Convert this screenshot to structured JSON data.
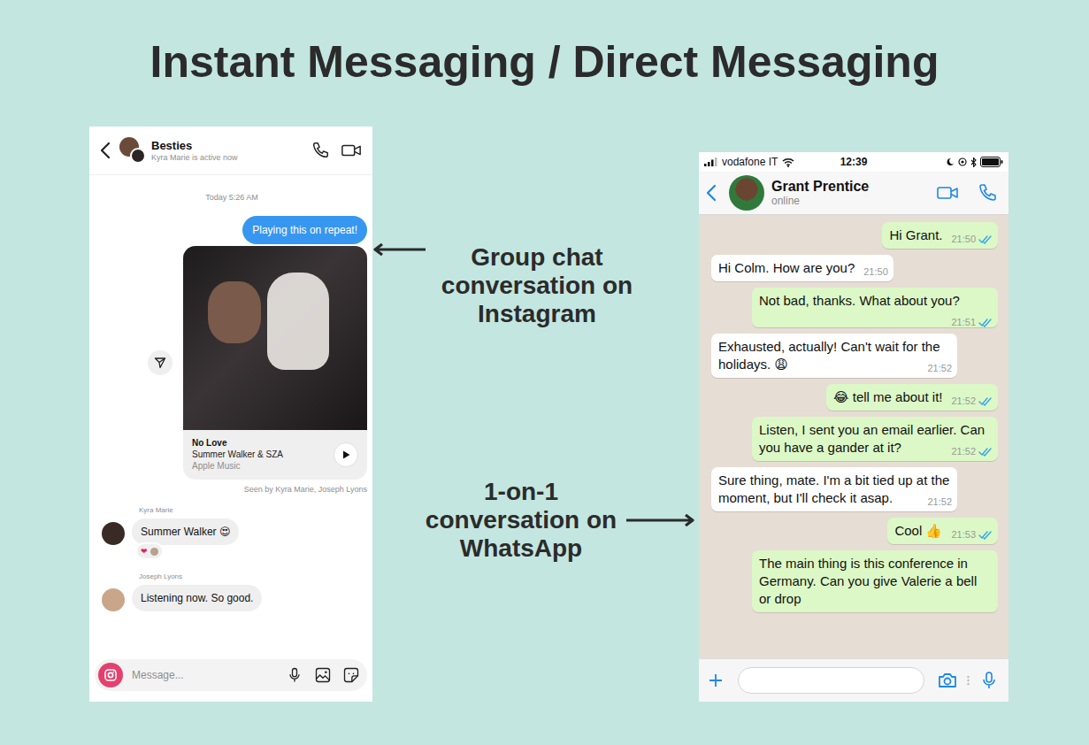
{
  "title": "Instant Messaging / Direct Messaging",
  "captions": [
    {
      "lines": [
        "Group chat",
        "conversation on",
        "Instagram"
      ],
      "kind": "left"
    },
    {
      "lines": [
        "1-on-1",
        "conversation on",
        "WhatsApp"
      ],
      "kind": "right"
    }
  ],
  "instagram": {
    "header": {
      "title": "Besties",
      "status": "Kyra Marie is active now"
    },
    "date": "Today 5:26 AM",
    "sent": "Playing this on repeat!",
    "track": {
      "title": "No Love",
      "artist": "Summer Walker & SZA",
      "source": "Apple Music"
    },
    "seen": "Seen by Kyra Marie, Joseph Lyons",
    "replies": [
      {
        "sender": "Kyra Marie",
        "text": "Summer Walker 😍",
        "reactions": [
          "❤"
        ],
        "color": "#3a2a26"
      },
      {
        "sender": "Joseph Lyons",
        "text": "Listening now. So good.",
        "reactions": [],
        "color": "#c9a58a"
      }
    ],
    "composer": {
      "placeholder": "Message..."
    }
  },
  "whatsapp": {
    "status_bar": {
      "carrier": "vodafone IT",
      "time": "12:39"
    },
    "contact": {
      "name": "Grant Prentice",
      "status": "online"
    },
    "messages": [
      {
        "kind": "sent",
        "text": "Hi Grant.",
        "time": "21:50",
        "read": true
      },
      {
        "kind": "received",
        "text": "Hi Colm. How are you?",
        "time": "21:50"
      },
      {
        "kind": "sent",
        "text": "Not bad, thanks. What about you?",
        "time": "21:51",
        "read": true
      },
      {
        "kind": "received",
        "text": "Exhausted, actually! Can't wait for the holidays. 😩",
        "time": "21:52"
      },
      {
        "kind": "sent",
        "text": "😂 tell me about it!",
        "time": "21:52",
        "read": true
      },
      {
        "kind": "sent",
        "text": "Listen, I sent you an email earlier. Can you have a gander at it?",
        "time": "21:52",
        "read": true
      },
      {
        "kind": "received",
        "text": "Sure thing, mate. I'm a bit tied up at the moment, but I'll check it asap.",
        "time": "21:52"
      },
      {
        "kind": "sent",
        "text": "Cool 👍",
        "time": "21:53",
        "read": true
      },
      {
        "kind": "sent",
        "text": "The main thing is this conference in Germany. Can you give Valerie a bell or drop"
      }
    ]
  }
}
